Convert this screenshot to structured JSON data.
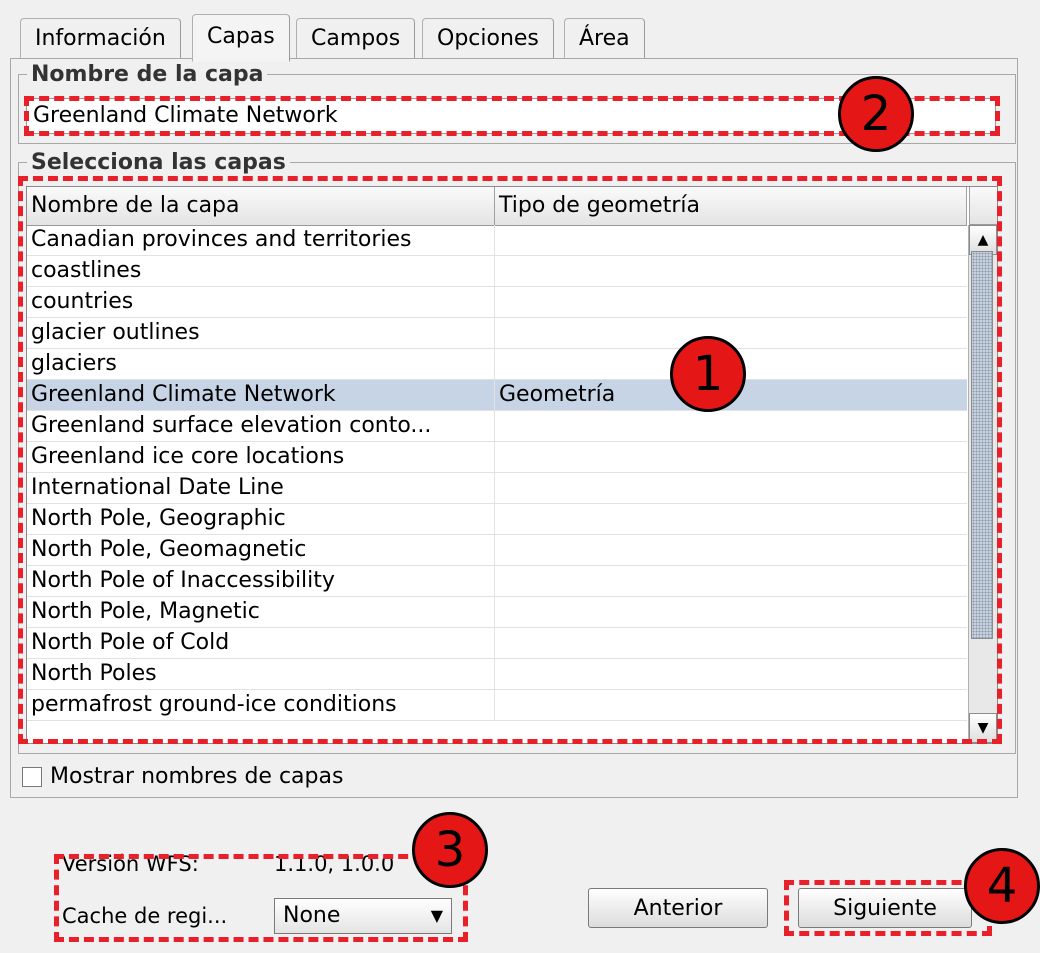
{
  "tabs": [
    "Información",
    "Capas",
    "Campos",
    "Opciones",
    "Área"
  ],
  "active_tab": "Capas",
  "layer_name_group": {
    "legend": "Nombre de la capa",
    "value": "Greenland Climate Network"
  },
  "select_layers_group": {
    "legend": "Selecciona las capas",
    "columns": [
      "Nombre de la capa",
      "Tipo de geometría"
    ],
    "rows": [
      {
        "name": "Canadian provinces and territories",
        "geom": ""
      },
      {
        "name": "coastlines",
        "geom": ""
      },
      {
        "name": "countries",
        "geom": ""
      },
      {
        "name": "glacier outlines",
        "geom": ""
      },
      {
        "name": "glaciers",
        "geom": ""
      },
      {
        "name": "Greenland Climate Network",
        "geom": "Geometría",
        "selected": true
      },
      {
        "name": "Greenland surface elevation conto...",
        "geom": ""
      },
      {
        "name": "Greenland ice core locations",
        "geom": ""
      },
      {
        "name": "International Date Line",
        "geom": ""
      },
      {
        "name": "North Pole, Geographic",
        "geom": ""
      },
      {
        "name": "North Pole, Geomagnetic",
        "geom": ""
      },
      {
        "name": "North Pole of Inaccessibility",
        "geom": ""
      },
      {
        "name": "North Pole, Magnetic",
        "geom": ""
      },
      {
        "name": "North Pole of Cold",
        "geom": ""
      },
      {
        "name": "North Poles",
        "geom": ""
      },
      {
        "name": "permafrost ground-ice conditions",
        "geom": ""
      }
    ]
  },
  "show_layer_names": {
    "label": "Mostrar nombres de capas",
    "checked": false
  },
  "wfs_version": {
    "label": "Versión WFS:",
    "value": "1.1.0, 1.0.0"
  },
  "cache": {
    "label": "Cache de regi...",
    "selected": "None"
  },
  "buttons": {
    "previous": "Anterior",
    "next": "Siguiente"
  },
  "callouts": [
    "1",
    "2",
    "3",
    "4"
  ],
  "colors": {
    "annotation": "#e8202a",
    "selection": "#c7d4e5"
  }
}
